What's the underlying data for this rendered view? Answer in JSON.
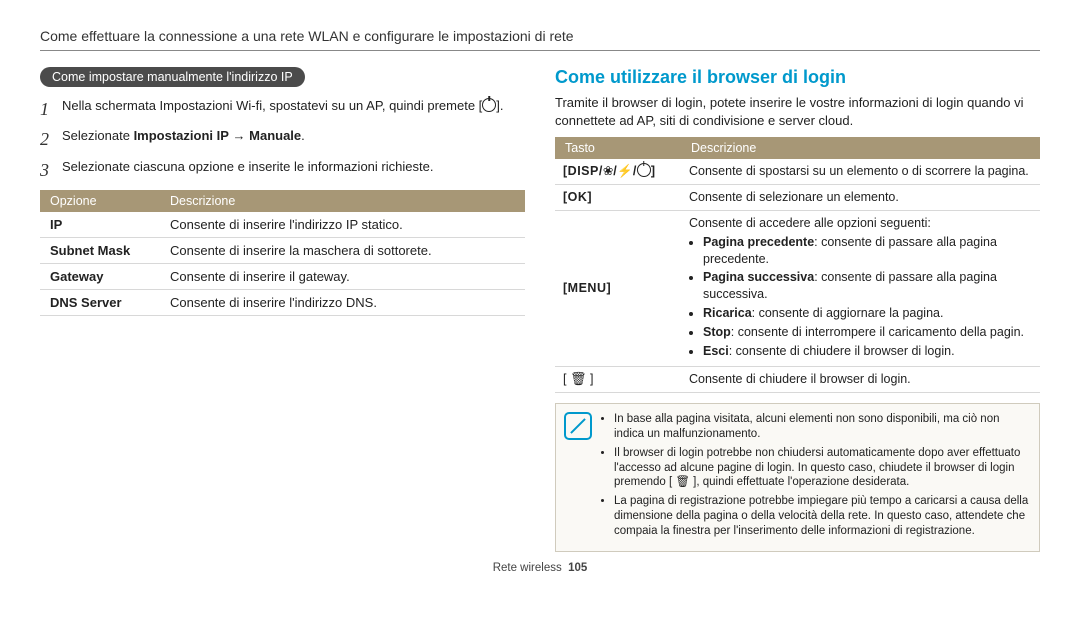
{
  "header": "Come effettuare la connessione a una rete WLAN e configurare le impostazioni di rete",
  "left": {
    "pill": "Come impostare manualmente l'indirizzo IP",
    "step1_a": "Nella schermata Impostazioni Wi-fi, spostatevi su un AP, quindi premete [",
    "step1_b": "].",
    "step2_a": "Selezionate ",
    "step2_b": "Impostazioni IP",
    "step2_c": " → ",
    "step2_d": "Manuale",
    "step2_e": ".",
    "step3": "Selezionate ciascuna opzione e inserite le informazioni richieste.",
    "table_h1": "Opzione",
    "table_h2": "Descrizione",
    "rows": [
      {
        "k": "IP",
        "v": "Consente di inserire l'indirizzo IP statico."
      },
      {
        "k": "Subnet Mask",
        "v": "Consente di inserire la maschera di sottorete."
      },
      {
        "k": "Gateway",
        "v": "Consente di inserire il gateway."
      },
      {
        "k": "DNS Server",
        "v": "Consente di inserire l'indirizzo DNS."
      }
    ]
  },
  "right": {
    "title": "Come utilizzare il browser di login",
    "intro": "Tramite il browser di login, potete inserire le vostre informazioni di login quando vi connettete ad AP, siti di condivisione e server cloud.",
    "th1": "Tasto",
    "th2": "Descrizione",
    "row1_key": "[DISP/",
    "row1_key_end": "]",
    "row1_desc": "Consente di spostarsi su un elemento o di scorrere la pagina.",
    "row2_key": "[OK]",
    "row2_desc": "Consente di selezionare un elemento.",
    "row3_key": "[MENU]",
    "row3_intro": "Consente di accedere alle opzioni seguenti:",
    "row3_items": [
      {
        "b": "Pagina precedente",
        "t": ": consente di passare alla pagina precedente."
      },
      {
        "b": "Pagina successiva",
        "t": ": consente di passare alla pagina successiva."
      },
      {
        "b": "Ricarica",
        "t": ": consente di aggiornare la pagina."
      },
      {
        "b": "Stop",
        "t": ": consente di interrompere il caricamento della pagin."
      },
      {
        "b": "Esci",
        "t": ": consente di chiudere il browser di login."
      }
    ],
    "row4_desc": "Consente di chiudere il browser di login.",
    "notes": [
      "In base alla pagina visitata, alcuni elementi non sono disponibili, ma ciò non indica un malfunzionamento.",
      "Il browser di login potrebbe non chiudersi automaticamente dopo aver effettuato l'accesso ad alcune pagine di login. In questo caso, chiudete il browser di login premendo [ 🗑 ], quindi effettuate l'operazione desiderata.",
      "La pagina di registrazione potrebbe impiegare più tempo a caricarsi a causa della dimensione della pagina o della velocità della rete. In questo caso, attendete che compaia la finestra per l'inserimento delle informazioni di registrazione."
    ]
  },
  "footer_label": "Rete wireless",
  "footer_page": "105"
}
